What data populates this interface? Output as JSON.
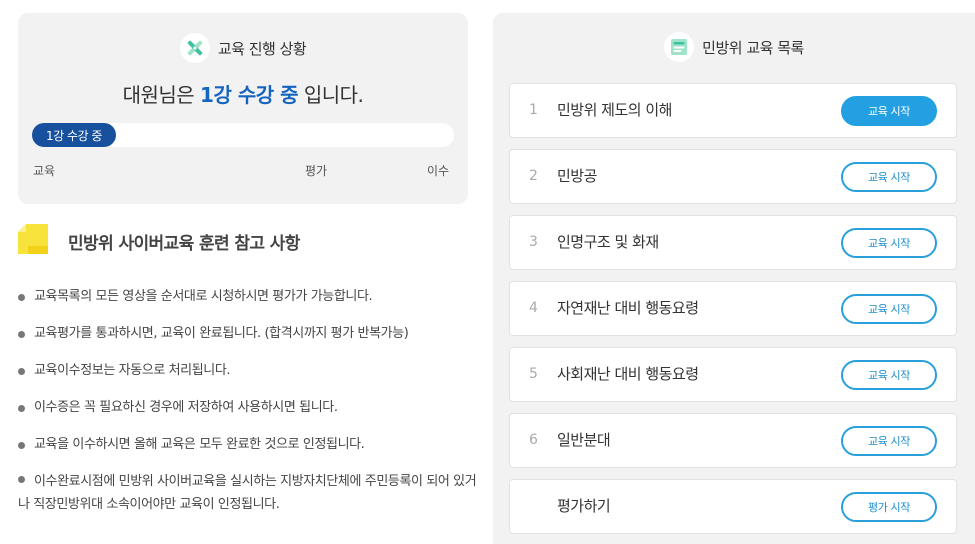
{
  "progress": {
    "header_icon": "pencil-ruler-icon",
    "title": "교육 진행 상황",
    "status_prefix": "대원님은 ",
    "status_highlight": "1강 수강 중",
    "status_suffix": " 입니다.",
    "bar_label": "1강 수강 중",
    "bar_fraction": 0.2,
    "stages": [
      "교육",
      "평가",
      "이수"
    ],
    "accent_color": "#17509c"
  },
  "notes": {
    "icon": "sticky-note-icon",
    "title": "민방위 사이버교육 훈련 참고 사항",
    "items": [
      "교육목록의 모든 영상을 순서대로 시청하시면 평가가 가능합니다.",
      "교육평가를 통과하시면, 교육이 완료됩니다. (합격시까지 평가 반복가능)",
      "교육이수정보는 자동으로 처리됩니다.",
      "이수증은 꼭 필요하신 경우에 저장하여 사용하시면 됩니다.",
      "교육을 이수하시면 올해 교육은 모두 완료한 것으로 인정됩니다.",
      "이수완료시점에 민방위 사이버교육을 실시하는 지방자치단체에 주민등록이 되어 있거나 직장민방위대 소속이어야만 교육이 인정됩니다."
    ]
  },
  "course_list": {
    "header_icon": "list-card-icon",
    "title": "민방위 교육 목록",
    "button_color": "#23a0e2",
    "courses": [
      {
        "num": "1",
        "title": "민방위 제도의 이해",
        "button": "교육 시작",
        "active": true
      },
      {
        "num": "2",
        "title": "민방공",
        "button": "교육 시작",
        "active": false
      },
      {
        "num": "3",
        "title": "인명구조 및 화재",
        "button": "교육 시작",
        "active": false
      },
      {
        "num": "4",
        "title": "자연재난 대비 행동요령",
        "button": "교육 시작",
        "active": false
      },
      {
        "num": "5",
        "title": "사회재난 대비 행동요령",
        "button": "교육 시작",
        "active": false
      },
      {
        "num": "6",
        "title": "일반분대",
        "button": "교육 시작",
        "active": false
      },
      {
        "num": "",
        "title": "평가하기",
        "button": "평가 시작",
        "active": false
      }
    ]
  }
}
